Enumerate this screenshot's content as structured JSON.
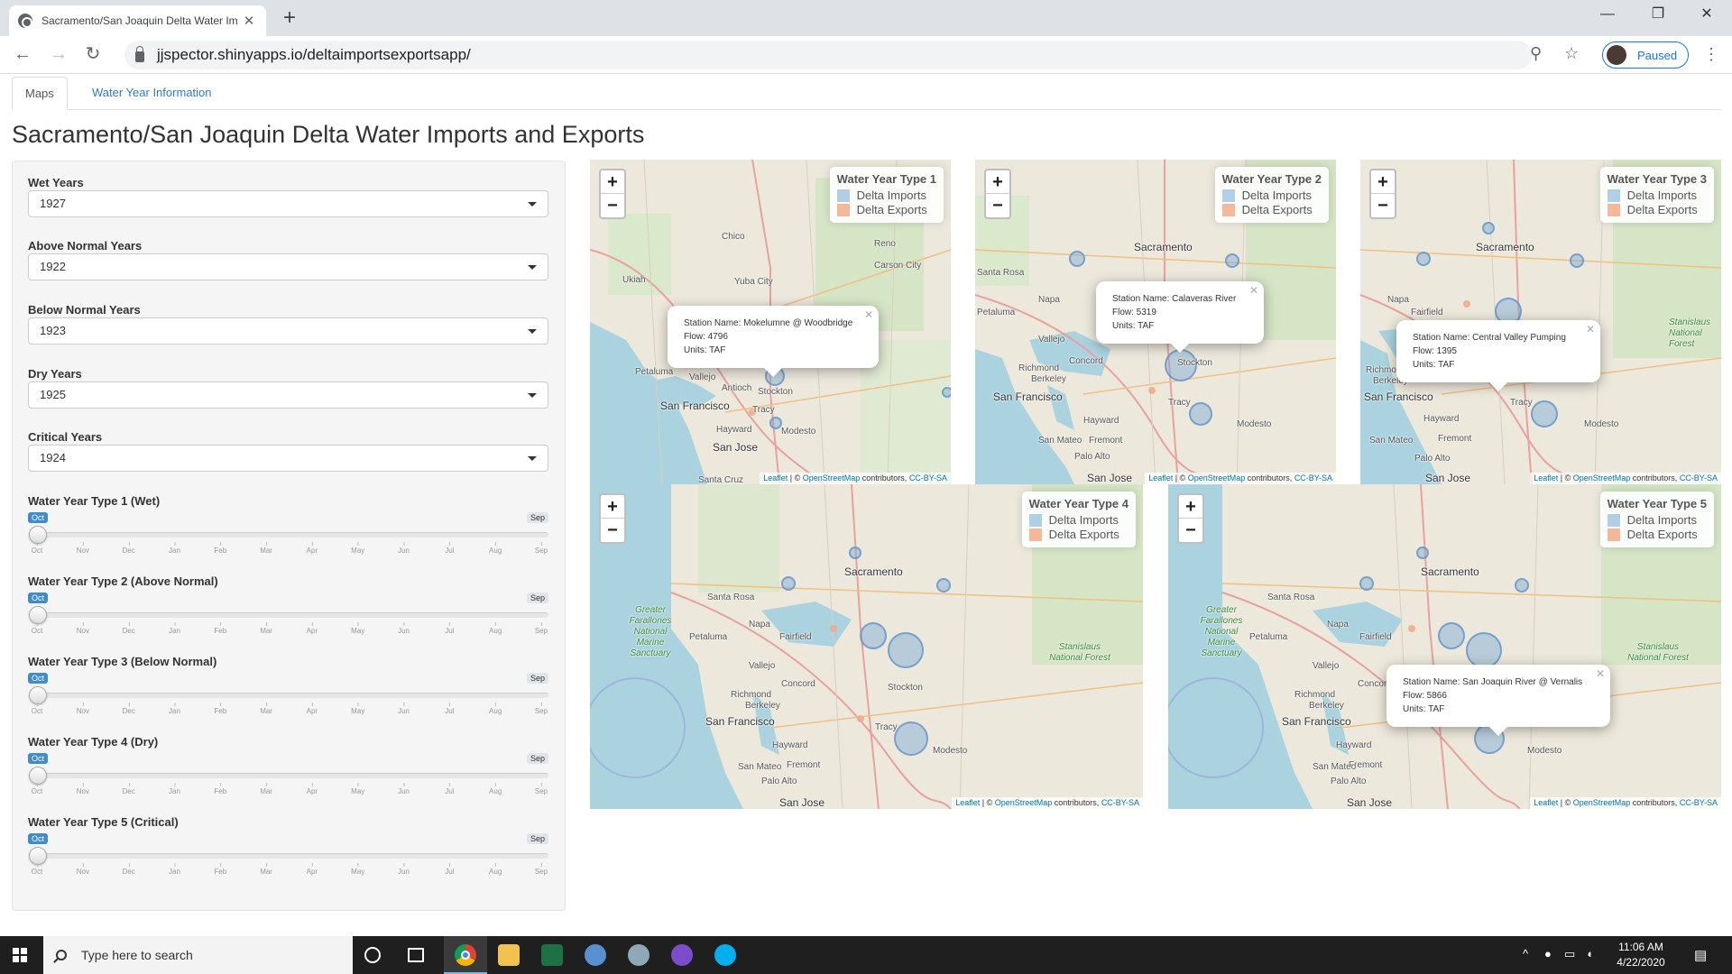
{
  "browser": {
    "tab_title": "Sacramento/San Joaquin Delta Water Im",
    "url": "jjspector.shinyapps.io/deltaimportsexportsapp/",
    "profile_label": "Paused"
  },
  "app": {
    "tabs": [
      {
        "label": "Maps",
        "active": true
      },
      {
        "label": "Water Year Information",
        "active": false
      }
    ],
    "title": "Sacramento/San Joaquin Delta Water Imports and Exports",
    "selects": [
      {
        "label": "Wet Years",
        "value": "1927"
      },
      {
        "label": "Above Normal Years",
        "value": "1922"
      },
      {
        "label": "Below Normal Years",
        "value": "1923"
      },
      {
        "label": "Dry Years",
        "value": "1925"
      },
      {
        "label": "Critical Years",
        "value": "1924"
      }
    ],
    "sliders": [
      {
        "label": "Water Year Type 1 (Wet)",
        "min_label": "Oct",
        "max_label": "Sep",
        "value_fraction": 0
      },
      {
        "label": "Water Year Type 2 (Above Normal)",
        "min_label": "Oct",
        "max_label": "Sep",
        "value_fraction": 0
      },
      {
        "label": "Water Year Type 3 (Below Normal)",
        "min_label": "Oct",
        "max_label": "Sep",
        "value_fraction": 0
      },
      {
        "label": "Water Year Type 4 (Dry)",
        "min_label": "Oct",
        "max_label": "Sep",
        "value_fraction": 0
      },
      {
        "label": "Water Year Type 5 (Critical)",
        "min_label": "Oct",
        "max_label": "Sep",
        "value_fraction": 0
      }
    ],
    "months": [
      "Oct",
      "Nov",
      "Dec",
      "Jan",
      "Feb",
      "Mar",
      "Apr",
      "May",
      "Jun",
      "Jul",
      "Aug",
      "Sep"
    ]
  },
  "maps": {
    "legend_items": [
      "Delta Imports",
      "Delta Exports"
    ],
    "import_color": "#9ec3de",
    "export_color": "#f4a582",
    "attribution": {
      "leaflet": "Leaflet",
      "sep": " | © ",
      "osm": "OpenStreetMap",
      "contrib": " contributors, ",
      "license": "CC-BY-SA"
    },
    "panels": [
      {
        "legend_title": "Water Year Type 1",
        "popup": {
          "station": "Station Name: Mokelumne @ Woodbridge",
          "flow": "Flow: 4796",
          "units": "Units: TAF"
        }
      },
      {
        "legend_title": "Water Year Type 2",
        "popup": {
          "station": "Station Name: Calaveras River",
          "flow": "Flow: 5319",
          "units": "Units: TAF"
        }
      },
      {
        "legend_title": "Water Year Type 3",
        "popup": {
          "station": "Station Name: Central Valley Pumping",
          "flow": "Flow: 1395",
          "units": "Units: TAF"
        }
      },
      {
        "legend_title": "Water Year Type 4",
        "popup": null
      },
      {
        "legend_title": "Water Year Type 5",
        "popup": {
          "station": "Station Name: San Joaquin River @ Vernalis",
          "flow": "Flow: 5866",
          "units": "Units: TAF"
        }
      }
    ],
    "place_labels": {
      "p1": [
        "Chico",
        "Reno",
        "Carson City",
        "Yuba City",
        "Ukiah",
        "Petaluma",
        "Vallejo",
        "Antioch",
        "Stockton",
        "San Francisco",
        "Tracy",
        "Modesto",
        "Hayward",
        "San Jose",
        "Santa Cruz"
      ],
      "p2": [
        "Sacramento",
        "Santa Rosa",
        "Petaluma",
        "Napa",
        "Vallejo",
        "Concord",
        "Richmond",
        "Berkeley",
        "San Francisco",
        "Stockton",
        "Tracy",
        "Modesto",
        "Hayward",
        "San Mateo",
        "Fremont",
        "Palo Alto",
        "San Jose"
      ],
      "p3": [
        "Sacramento",
        "Napa",
        "Fairfield",
        "Richmond",
        "Berkeley",
        "San Francisco",
        "Tracy",
        "Hayward",
        "San Mateo",
        "Fremont",
        "Modesto",
        "Palo Alto",
        "San Jose",
        "Stanislaus National Forest"
      ],
      "p4": [
        "Sacramento",
        "Santa Rosa",
        "Napa",
        "Fairfield",
        "Petaluma",
        "Vallejo",
        "Concord",
        "Richmond",
        "Berkeley",
        "San Francisco",
        "Stockton",
        "Tracy",
        "Hayward",
        "Modesto",
        "Fremont",
        "San Mateo",
        "Palo Alto",
        "San Jose",
        "Greater Farallones National Marine Sanctuary",
        "Stanislaus National Forest"
      ],
      "p5": [
        "Sacramento",
        "Santa Rosa",
        "Napa",
        "Fairfield",
        "Petaluma",
        "Vallejo",
        "Concord",
        "Richmond",
        "Berkeley",
        "San Francisco",
        "Hayward",
        "Modesto",
        "Fremont",
        "San Mateo",
        "Palo Alto",
        "San Jose",
        "Greater Farallones National Marine Sanctuary",
        "Stanislaus National Forest"
      ]
    }
  },
  "taskbar": {
    "search_placeholder": "Type here to search",
    "time": "11:06 AM",
    "date": "4/22/2020"
  }
}
